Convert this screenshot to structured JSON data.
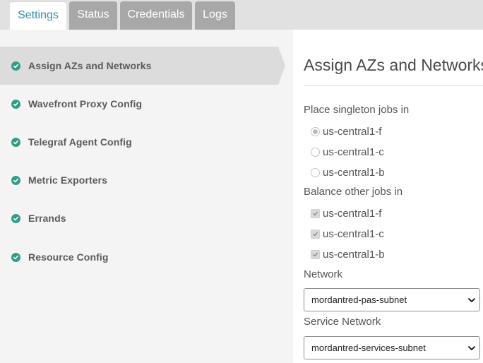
{
  "tabs": [
    {
      "label": "Settings",
      "active": true
    },
    {
      "label": "Status",
      "active": false
    },
    {
      "label": "Credentials",
      "active": false
    },
    {
      "label": "Logs",
      "active": false
    }
  ],
  "sidebar": {
    "items": [
      {
        "label": "Assign AZs and Networks",
        "complete": true,
        "active": true
      },
      {
        "label": "Wavefront Proxy Config",
        "complete": true,
        "active": false
      },
      {
        "label": "Telegraf Agent Config",
        "complete": true,
        "active": false
      },
      {
        "label": "Metric Exporters",
        "complete": true,
        "active": false
      },
      {
        "label": "Errands",
        "complete": true,
        "active": false
      },
      {
        "label": "Resource Config",
        "complete": true,
        "active": false
      }
    ]
  },
  "main": {
    "title": "Assign AZs and Networks",
    "singleton": {
      "label": "Place singleton jobs in",
      "options": [
        {
          "label": "us-central1-f",
          "selected": true
        },
        {
          "label": "us-central1-c",
          "selected": false
        },
        {
          "label": "us-central1-b",
          "selected": false
        }
      ]
    },
    "balance": {
      "label": "Balance other jobs in",
      "options": [
        {
          "label": "us-central1-f",
          "checked": true
        },
        {
          "label": "us-central1-c",
          "checked": true
        },
        {
          "label": "us-central1-b",
          "checked": true
        }
      ]
    },
    "network": {
      "label": "Network",
      "value": "mordantred-pas-subnet"
    },
    "service_network": {
      "label": "Service Network",
      "value": "mordantred-services-subnet"
    }
  },
  "colors": {
    "tab_active_text": "#2f8fab",
    "tab_inactive_bg": "#a8a8a8",
    "tabbar_bg": "#e1e1e1",
    "sidebar_bg": "#f4f4f4",
    "sidebar_active_bg": "#dcdcdc",
    "check_green": "#2e9e87"
  },
  "icons": {
    "sidebar_status": "check-circle-icon",
    "select_arrow": "chevron-down-icon"
  }
}
